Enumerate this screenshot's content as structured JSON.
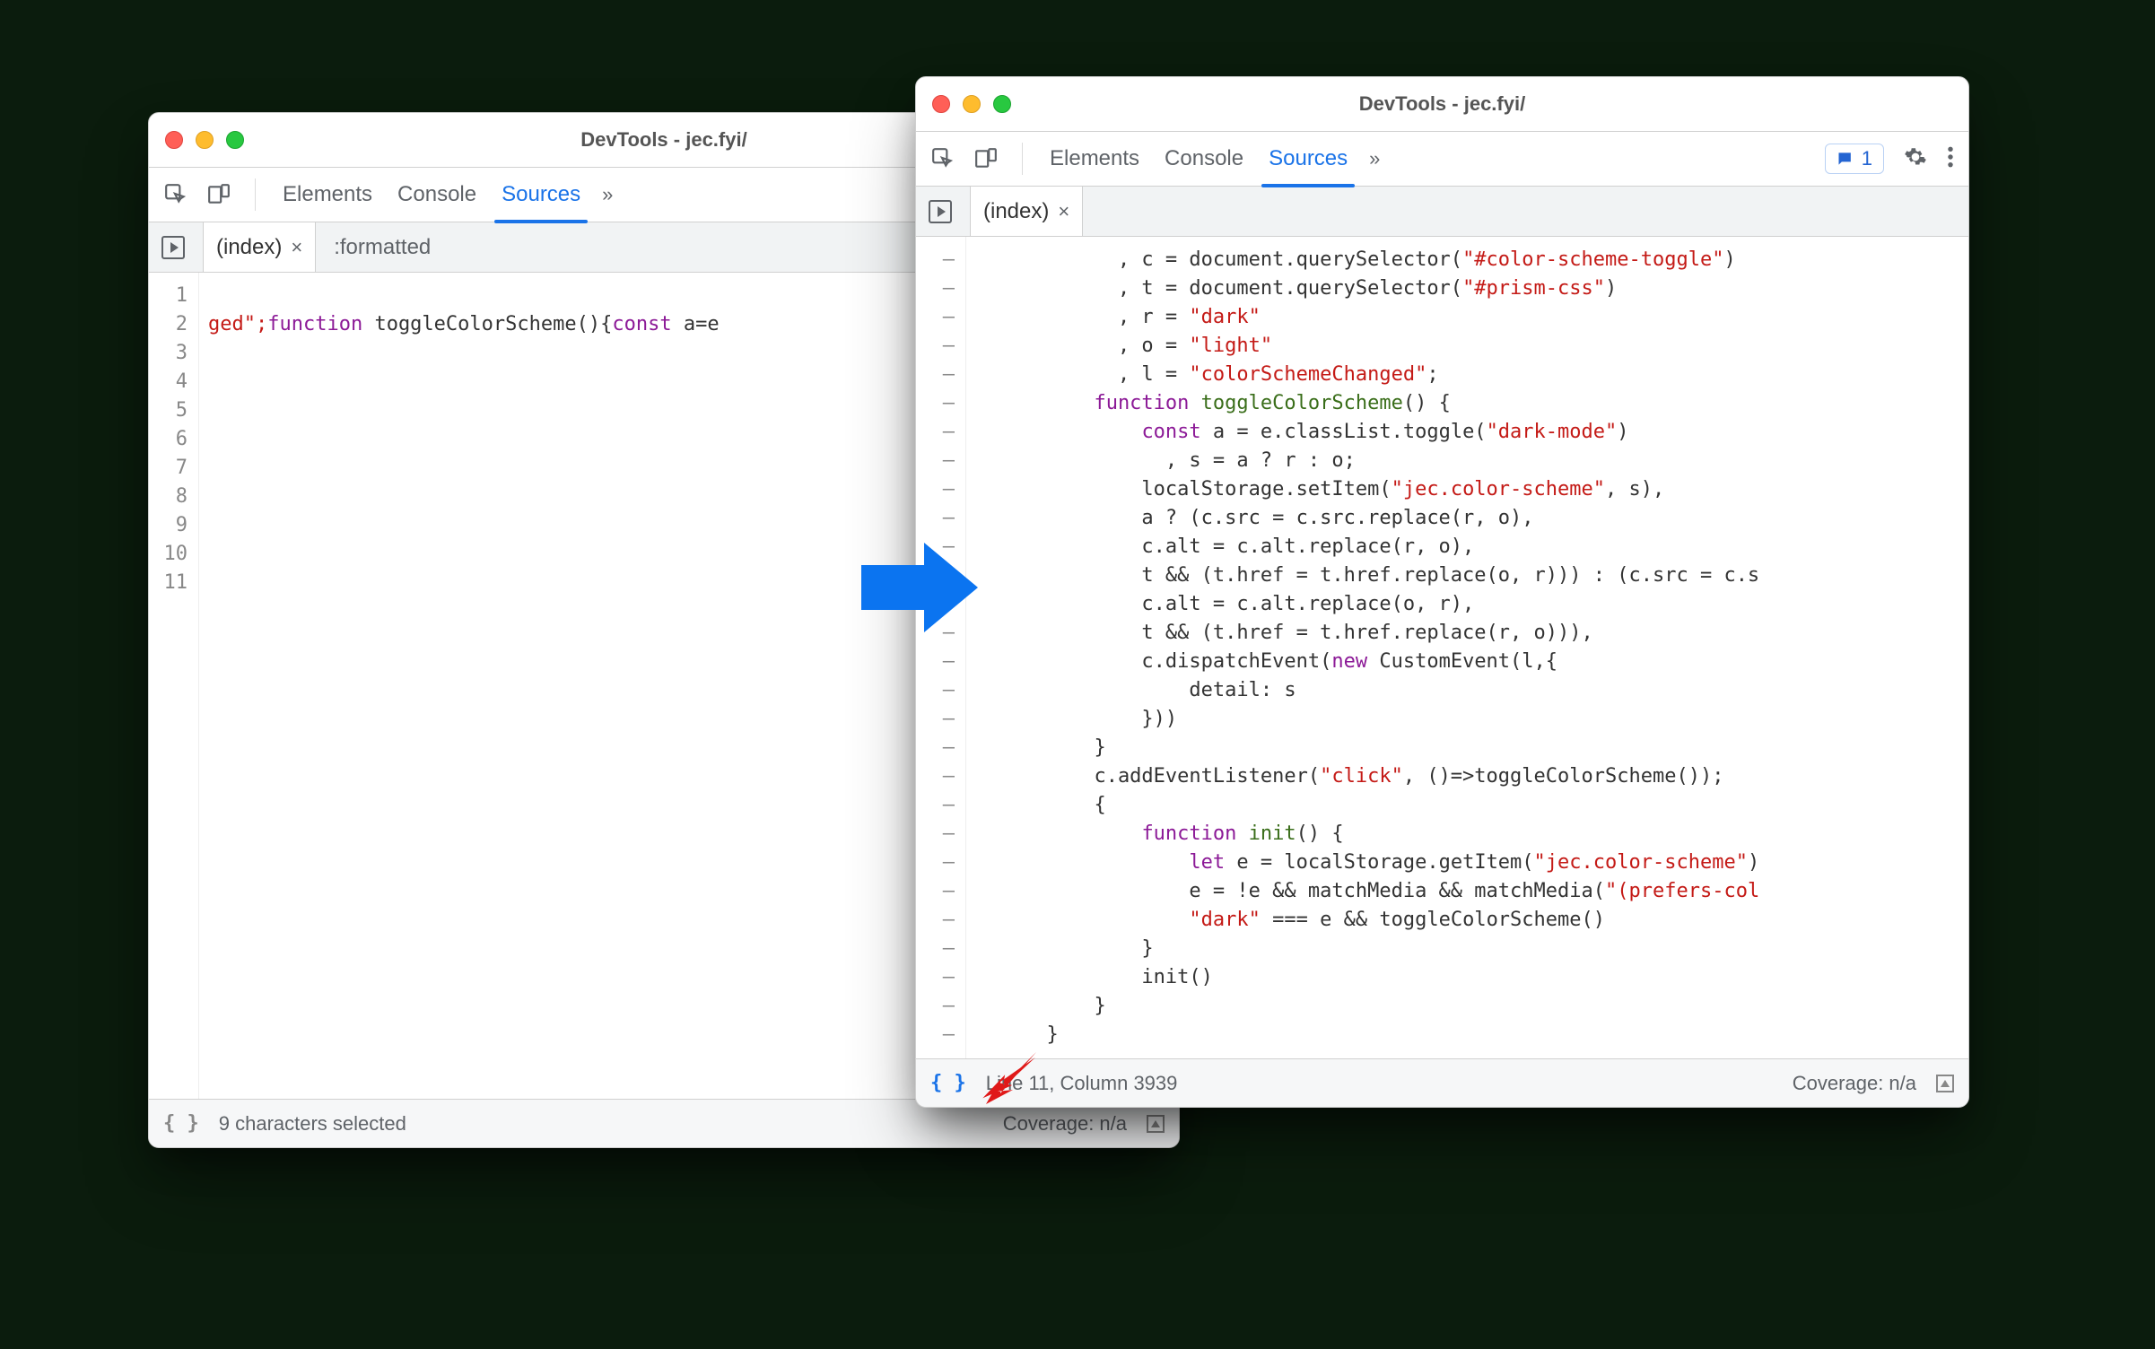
{
  "left_window": {
    "title": "DevTools - jec.fyi/",
    "tabs": {
      "elements": "Elements",
      "console": "Console",
      "sources": "Sources",
      "more": "»"
    },
    "filetabs": {
      "index": "(index)",
      "formatted": ":formatted"
    },
    "line_numbers": [
      "1",
      "2",
      "3",
      "4",
      "5",
      "6",
      "7",
      "8",
      "9",
      "10",
      "11"
    ],
    "code_line11": {
      "pre": "ged\";",
      "kw_function": "function",
      "fn_name": " toggleColorScheme(){",
      "kw_const": "const",
      "tail": " a=e"
    },
    "footer": {
      "braces": "{ }",
      "status": "9 characters selected",
      "coverage": "Coverage: n/a"
    }
  },
  "right_window": {
    "title": "DevTools - jec.fyi/",
    "tabs": {
      "elements": "Elements",
      "console": "Console",
      "sources": "Sources",
      "more": "»"
    },
    "issues_count": "1",
    "filetabs": {
      "index": "(index)"
    },
    "code_lines": [
      {
        "t": "            , c = document.querySelector(",
        "s": "\"#color-scheme-toggle\"",
        "t2": ")"
      },
      {
        "t": "            , t = document.querySelector(",
        "s": "\"#prism-css\"",
        "t2": ")"
      },
      {
        "t": "            , r = ",
        "s": "\"dark\"",
        "t2": ""
      },
      {
        "t": "            , o = ",
        "s": "\"light\"",
        "t2": ""
      },
      {
        "t": "            , l = ",
        "s": "\"colorSchemeChanged\"",
        "t2": ";"
      },
      {
        "kw": "          function ",
        "fn": "toggleColorScheme",
        "t": "() {"
      },
      {
        "t": "              ",
        "kw": "const",
        "t2": " a = e.classList.toggle(",
        "s": "\"dark-mode\"",
        "t3": ")"
      },
      {
        "t": "                , s = a ? r : o;"
      },
      {
        "t": "              localStorage.setItem(",
        "s": "\"jec.color-scheme\"",
        "t2": ", s),"
      },
      {
        "t": "              a ? (c.src = c.src.replace(r, o),"
      },
      {
        "t": "              c.alt = c.alt.replace(r, o),"
      },
      {
        "t": "              t && (t.href = t.href.replace(o, r))) : (c.src = c.s"
      },
      {
        "t": "              c.alt = c.alt.replace(o, r),"
      },
      {
        "t": "              t && (t.href = t.href.replace(r, o))),"
      },
      {
        "t": "              c.dispatchEvent(",
        "kw2": "new",
        "t2": " CustomEvent(l,{"
      },
      {
        "t": "                  detail: s"
      },
      {
        "t": "              }))"
      },
      {
        "t": "          }"
      },
      {
        "t": "          c.addEventListener(",
        "s": "\"click\"",
        "t2": ", ()=>toggleColorScheme());"
      },
      {
        "t": "          {"
      },
      {
        "t": "              ",
        "kw": "function ",
        "fn": "init",
        "t2": "() {"
      },
      {
        "t": "                  ",
        "kw": "let",
        "t2": " e = localStorage.getItem(",
        "s": "\"jec.color-scheme\"",
        "t3": ")"
      },
      {
        "t": "                  e = !e && matchMedia && matchMedia(",
        "s": "\"(prefers-col",
        "t2": ""
      },
      {
        "t": "                  ",
        "s": "\"dark\"",
        "t2": " === e && toggleColorScheme()"
      },
      {
        "t": "              }"
      },
      {
        "t": "              init()"
      },
      {
        "t": "          }"
      },
      {
        "t": "      }"
      }
    ],
    "footer": {
      "braces": "{ }",
      "status": "Line 11, Column 3939",
      "coverage": "Coverage: n/a"
    }
  }
}
